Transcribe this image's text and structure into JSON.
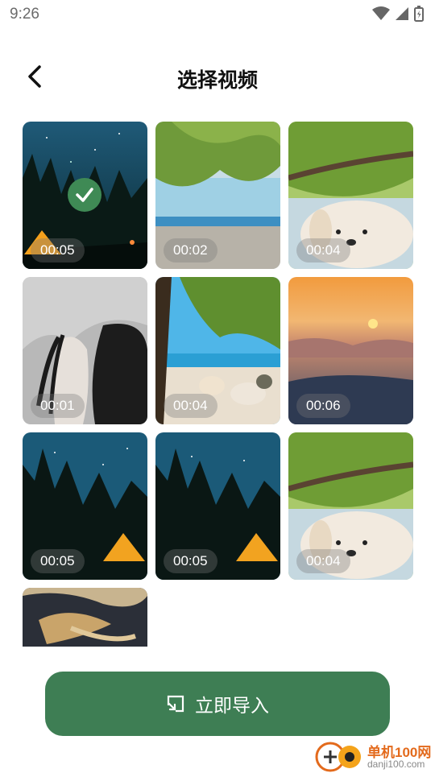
{
  "status_bar": {
    "time": "9:26"
  },
  "header": {
    "title": "选择视频"
  },
  "videos": [
    {
      "duration": "00:05",
      "scene": "starry-forest-tent",
      "selected": true
    },
    {
      "duration": "00:02",
      "scene": "beach-tree",
      "selected": false
    },
    {
      "duration": "00:04",
      "scene": "puppy",
      "selected": false
    },
    {
      "duration": "00:01",
      "scene": "woman-horse",
      "selected": false
    },
    {
      "duration": "00:04",
      "scene": "beach-cats",
      "selected": false
    },
    {
      "duration": "00:06",
      "scene": "sunset-clouds",
      "selected": false
    },
    {
      "duration": "00:05",
      "scene": "night-forest-tent",
      "selected": false
    },
    {
      "duration": "00:05",
      "scene": "night-forest-tent",
      "selected": false
    },
    {
      "duration": "00:04",
      "scene": "puppy",
      "selected": false
    },
    {
      "duration": "",
      "scene": "dark-horse",
      "selected": false
    }
  ],
  "import_button": {
    "label": "立即导入"
  },
  "watermark": {
    "text": "单机100网",
    "sub": "danji100.com"
  },
  "colors": {
    "accent": "#3e7e54",
    "check": "#3f8a55"
  }
}
